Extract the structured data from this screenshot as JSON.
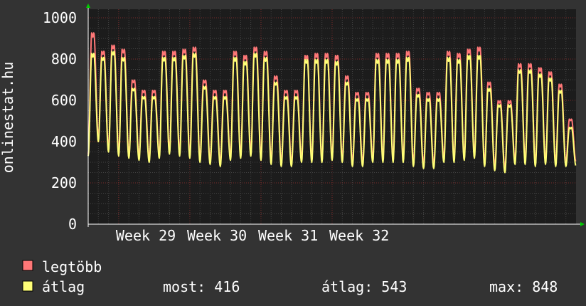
{
  "side_label": "onlinestat.hu",
  "stats": {
    "most_label": "most: 416",
    "atlag_label": "átlag: 543",
    "max_label": "max: 848"
  },
  "colors": {
    "background": "#333333",
    "plot_bg": "#1c1c1c",
    "grid_major": "#7a2a2a",
    "grid_minor": "#444444",
    "axis": "#ffffff",
    "arrow": "#00cc00"
  },
  "chart_data": {
    "type": "line",
    "title": "",
    "xlabel": "",
    "ylabel": "onlinestat.hu",
    "ylim": [
      0,
      1000
    ],
    "yticks": [
      0,
      200,
      400,
      600,
      800,
      1000
    ],
    "xticks": [
      "Week 29",
      "Week 30",
      "Week 31",
      "Week 32"
    ],
    "grid": true,
    "legend_position": "bottom-left",
    "days": 48,
    "series": [
      {
        "name": "legtöbb",
        "color": "#ff7777",
        "daily_peak": [
          930,
          840,
          870,
          850,
          700,
          650,
          650,
          840,
          840,
          850,
          860,
          700,
          650,
          650,
          840,
          820,
          860,
          840,
          720,
          650,
          650,
          820,
          830,
          830,
          820,
          720,
          640,
          640,
          830,
          830,
          830,
          840,
          660,
          640,
          640,
          840,
          830,
          850,
          860,
          690,
          600,
          600,
          780,
          780,
          760,
          740,
          680,
          510
        ],
        "daily_low": [
          340,
          420,
          370,
          350,
          340,
          330,
          320,
          340,
          360,
          350,
          340,
          320,
          310,
          300,
          330,
          340,
          350,
          330,
          310,
          300,
          300,
          320,
          320,
          320,
          330,
          320,
          300,
          300,
          320,
          320,
          320,
          320,
          300,
          290,
          290,
          320,
          320,
          330,
          340,
          300,
          280,
          270,
          310,
          310,
          300,
          310,
          300,
          300
        ]
      },
      {
        "name": "átlag",
        "color": "#ffff77",
        "daily_peak": [
          830,
          810,
          840,
          810,
          660,
          620,
          620,
          810,
          810,
          820,
          830,
          670,
          620,
          620,
          810,
          790,
          830,
          810,
          690,
          620,
          620,
          800,
          800,
          800,
          790,
          690,
          610,
          610,
          800,
          800,
          800,
          810,
          630,
          610,
          610,
          810,
          800,
          820,
          820,
          660,
          580,
          580,
          750,
          750,
          730,
          710,
          650,
          470
        ],
        "daily_low": [
          330,
          400,
          350,
          330,
          320,
          310,
          300,
          320,
          340,
          330,
          320,
          300,
          290,
          280,
          310,
          320,
          330,
          310,
          290,
          280,
          280,
          300,
          300,
          300,
          310,
          300,
          280,
          280,
          300,
          300,
          300,
          300,
          280,
          270,
          270,
          300,
          300,
          310,
          320,
          280,
          260,
          250,
          290,
          290,
          280,
          290,
          280,
          280
        ]
      }
    ]
  }
}
